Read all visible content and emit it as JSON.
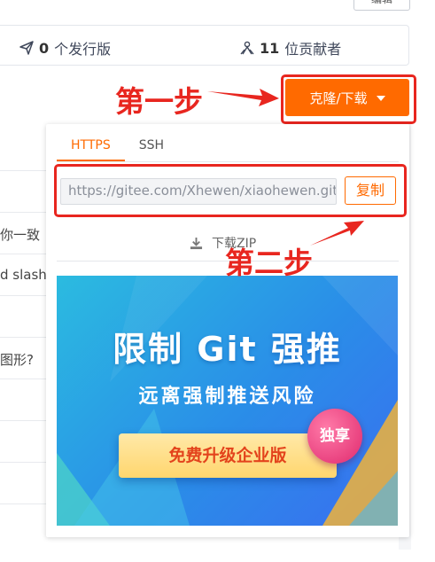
{
  "header": {
    "edit_label": "编辑"
  },
  "stats": {
    "releases_count": "0",
    "releases_label": "个发行版",
    "contributors_count": "11",
    "contributors_label": "位贡献者"
  },
  "clone_button": {
    "label": "克隆/下载"
  },
  "dropdown": {
    "tabs": [
      {
        "label": "HTTPS",
        "active": true
      },
      {
        "label": "SSH",
        "active": false
      }
    ],
    "url_value": "https://gitee.com/Xhewen/xiaohewen.git",
    "copy_label": "复制",
    "zip_label": "下载ZIP"
  },
  "banner": {
    "title": "限制 Git 强推",
    "subtitle": "远离强制推送风险",
    "cta": "免费升级企业版",
    "badge": "独享"
  },
  "annotations": {
    "step1": "第一步",
    "step2": "第二步"
  },
  "background_rows": [
    "你一致",
    "d slash",
    "图形?"
  ],
  "colors": {
    "accent": "#ff6a00",
    "annotation": "#e8261f"
  }
}
